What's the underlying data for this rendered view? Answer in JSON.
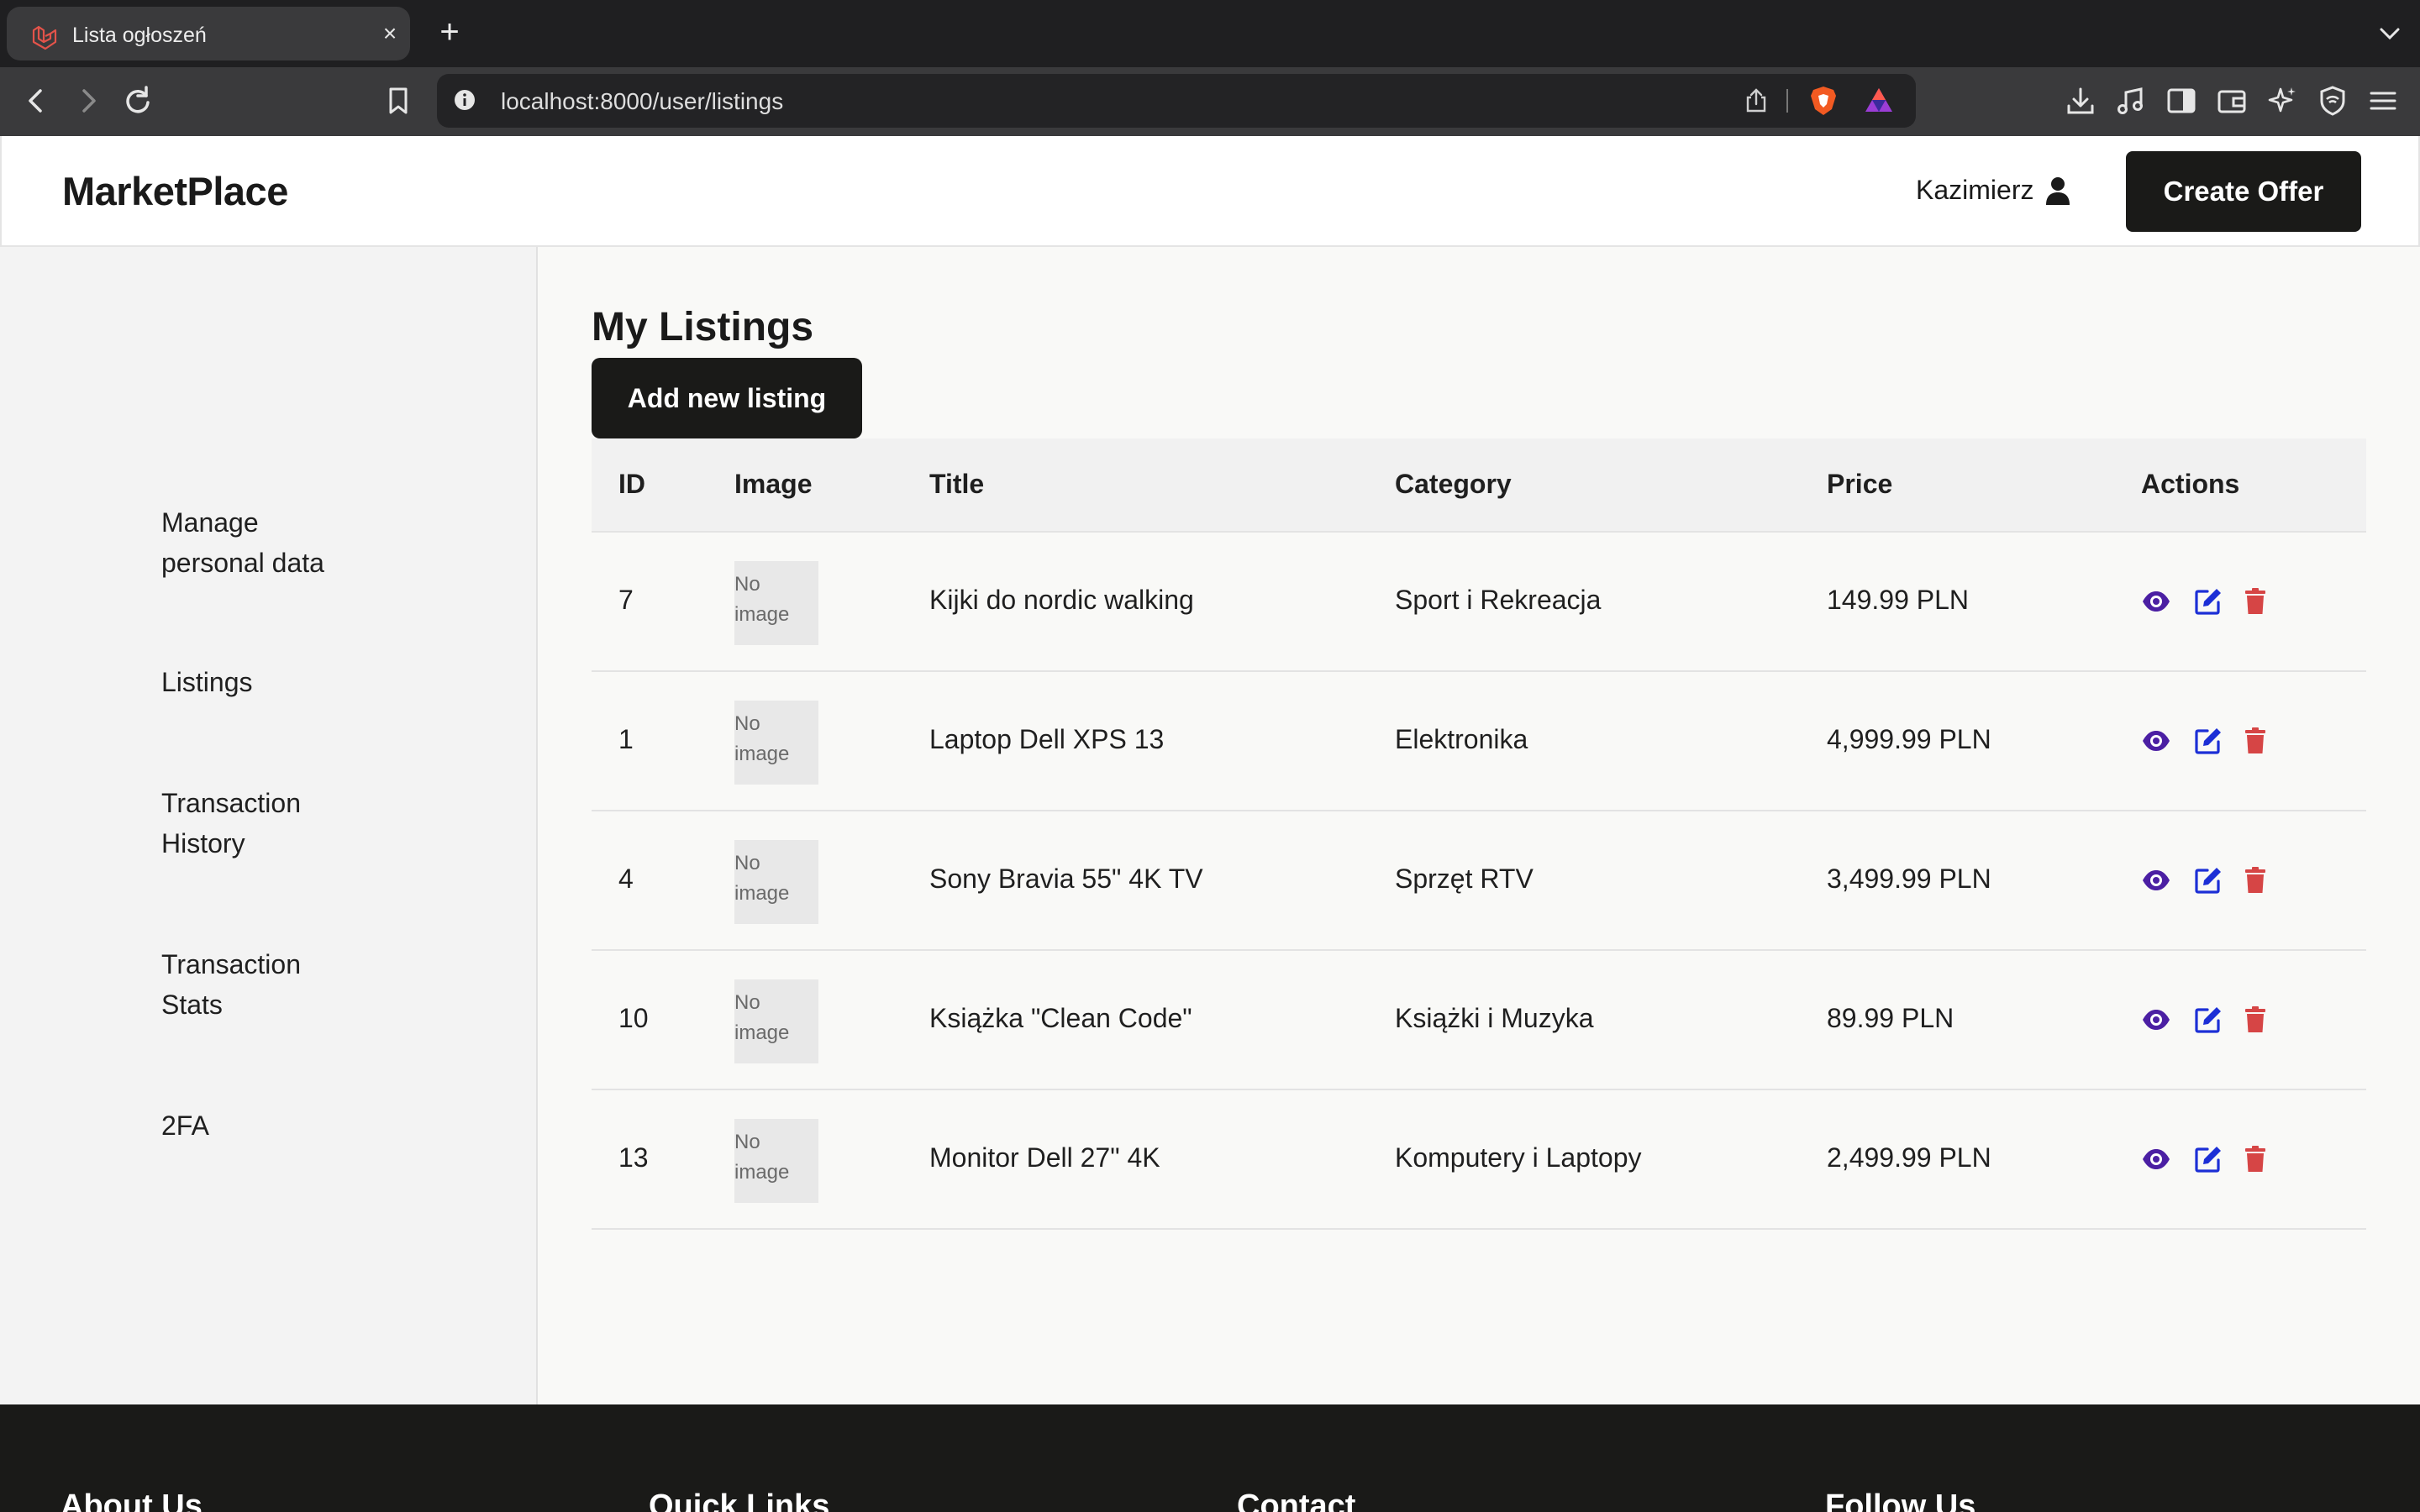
{
  "browser": {
    "tab_title": "Lista ogłoszeń",
    "tab_close": "×",
    "new_tab": "+",
    "url": "localhost:8000/user/listings"
  },
  "header": {
    "logo": "MarketPlace",
    "username": "Kazimierz",
    "create_offer": "Create Offer"
  },
  "sidebar": {
    "items": [
      {
        "line1": "Manage",
        "line2": "personal data"
      },
      {
        "line1": "Listings",
        "line2": ""
      },
      {
        "line1": "Transaction",
        "line2": "History"
      },
      {
        "line1": "Transaction",
        "line2": "Stats"
      },
      {
        "line1": "2FA",
        "line2": ""
      }
    ]
  },
  "main": {
    "title": "My Listings",
    "add_button": "Add new listing",
    "columns": [
      "ID",
      "Image",
      "Title",
      "Category",
      "Price",
      "Actions"
    ],
    "no_image_line1": "No",
    "no_image_line2": "image",
    "rows": [
      {
        "id": "7",
        "title": "Kijki do nordic walking",
        "category": "Sport i Rekreacja",
        "price": "149.99 PLN"
      },
      {
        "id": "1",
        "title": "Laptop Dell XPS 13",
        "category": "Elektronika",
        "price": "4,999.99 PLN"
      },
      {
        "id": "4",
        "title": "Sony Bravia 55\" 4K TV",
        "category": "Sprzęt RTV",
        "price": "3,499.99 PLN"
      },
      {
        "id": "10",
        "title": "Książka \"Clean Code\"",
        "category": "Książki i Muzyka",
        "price": "89.99 PLN"
      },
      {
        "id": "13",
        "title": "Monitor Dell 27\" 4K",
        "category": "Komputery i Laptopy",
        "price": "2,499.99 PLN"
      }
    ],
    "icons": {
      "view": "eye-icon",
      "edit": "edit-icon",
      "delete": "trash-icon"
    }
  },
  "footer": {
    "headings": [
      "About Us",
      "Quick Links",
      "Contact",
      "Follow Us"
    ]
  },
  "colors": {
    "view": "#4b1fa3",
    "edit": "#1c2fd6",
    "delete": "#d64545",
    "dark_button": "#1a1a18"
  }
}
